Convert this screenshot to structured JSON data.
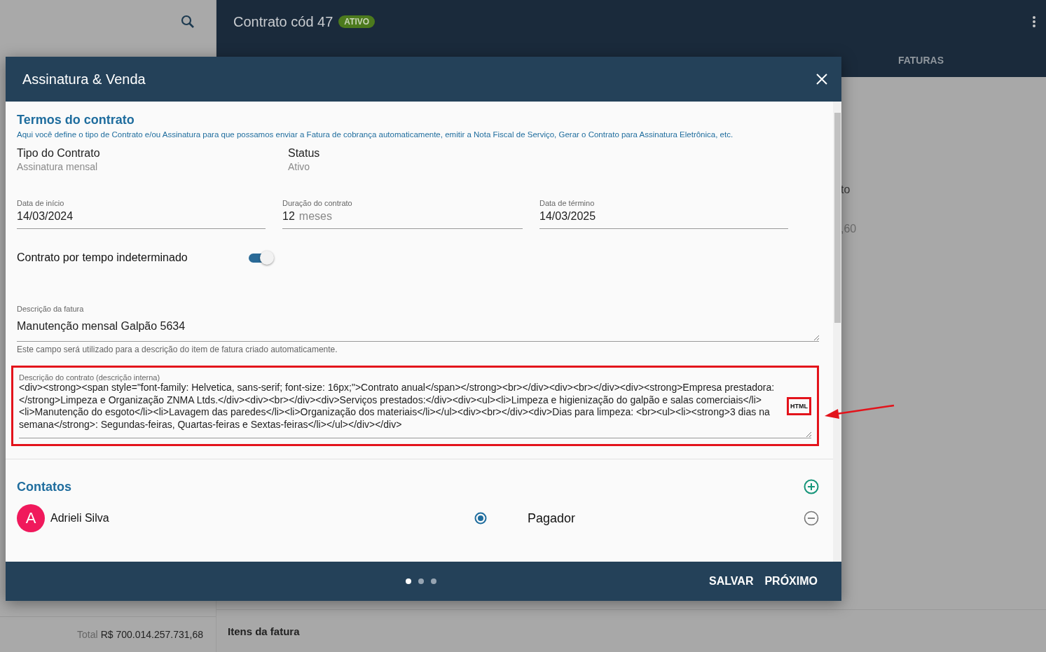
{
  "background": {
    "header_title": "Contrato cód 47",
    "status_badge": "ATIVO",
    "tab_label": "FATURAS",
    "fragments": [
      "to",
      ",60"
    ],
    "total_label": "Total",
    "total_value": "R$ 700.014.257.731,68",
    "section_title": "Itens da fatura"
  },
  "dialog": {
    "title": "Assinatura & Venda",
    "section": {
      "title": "Termos do contrato",
      "subtitle": "Aqui você define o tipo de Contrato e/ou Assinatura para que possamos enviar a Fatura de cobrança automaticamente, emitir a Nota Fiscal de Serviço, Gerar o Contrato para Assinatura Eletrônica, etc."
    },
    "info": [
      {
        "label": "Tipo do Contrato",
        "value": "Assinatura mensal"
      },
      {
        "label": "Status",
        "value": "Ativo"
      }
    ],
    "fields": [
      {
        "label": "Data de início",
        "value": "14/03/2024"
      },
      {
        "label": "Duração do contrato",
        "value": "12",
        "suffix": "meses"
      },
      {
        "label": "Data de término",
        "value": "14/03/2025"
      }
    ],
    "toggle": {
      "label": "Contrato por tempo indeterminado",
      "on": true
    },
    "invoice_description": {
      "label": "Descrição da fatura",
      "value": "Manutenção mensal Galpão 5634",
      "hint": "Este campo será utilizado para a descrição do item de fatura criado automaticamente."
    },
    "contract_description": {
      "label": "Descrição do contrato (descrição interna)",
      "value": "<div><strong><span style=\"font-family: Helvetica, sans-serif; font-size: 16px;\">Contrato anual</span></strong><br></div><div><br></div><div><strong>Empresa prestadora: </strong>Limpeza e Organização ZNMA Ltds.</div><div><br></div><div>Serviços prestados:</div><div><ul><li>Limpeza e higienização do galpão e salas comerciais</li><li>Manutenção do esgoto</li><li>Lavagem das paredes</li><li>Organização dos materiais</li></ul><div><br></div><div>Dias para limpeza: <br><ul><li><strong>3 dias na semana</strong>: Segundas-feiras, Quartas-feiras e Sextas-feiras</li></ul></div></div>",
      "badge": "HTML",
      "highlighted": true
    },
    "contacts": {
      "title": "Contatos",
      "items": [
        {
          "initial": "A",
          "name": "Adrieli Silva",
          "selected": true,
          "role": "Pagador"
        }
      ]
    },
    "pager": [
      {
        "selected": true
      },
      {
        "selected": false
      },
      {
        "selected": false
      }
    ],
    "actions": [
      "SALVAR",
      "PRÓXIMO"
    ]
  }
}
